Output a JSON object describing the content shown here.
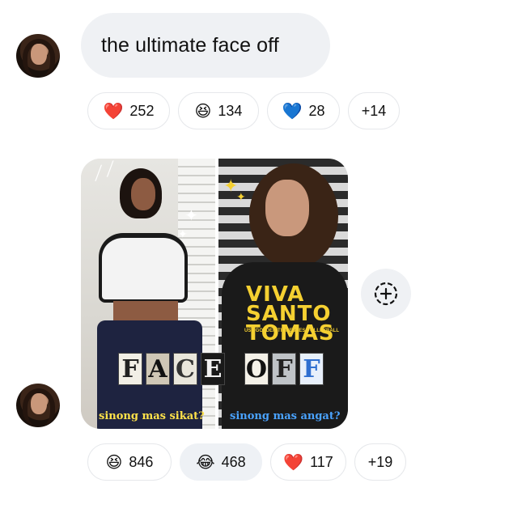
{
  "messages": [
    {
      "text": "the ultimate face off",
      "reactions": [
        {
          "emoji": "❤️",
          "icon": "red-heart-emoji",
          "count": "252"
        },
        {
          "emoji": "😆",
          "icon": "laughing-face-emoji",
          "count": "134"
        },
        {
          "emoji": "💙",
          "icon": "blue-heart-emoji",
          "count": "28"
        },
        {
          "more": "+14"
        }
      ]
    },
    {
      "image": {
        "letters": [
          "F",
          "A",
          "C",
          "E",
          "O",
          "F",
          "F"
        ],
        "caption_left": "sinong mas sikat?",
        "caption_right": "sinong mas angat?",
        "shirt_text": "VIVA SANTO TOMAS",
        "shirt_subtext": "UST GOLDEN TIGRESSES VOLLEYBALL"
      },
      "reactions": [
        {
          "emoji": "😆",
          "icon": "laughing-face-emoji",
          "count": "846"
        },
        {
          "emoji": "😂",
          "icon": "tears-of-joy-emoji",
          "count": "468",
          "selected": true
        },
        {
          "emoji": "❤️",
          "icon": "red-heart-emoji",
          "count": "117"
        },
        {
          "more": "+19"
        }
      ]
    }
  ],
  "colors": {
    "bubble": "#eff1f4",
    "pill_border": "#e6e8eb",
    "caption_left": "#ffe24a",
    "caption_right": "#4aa3ff"
  }
}
